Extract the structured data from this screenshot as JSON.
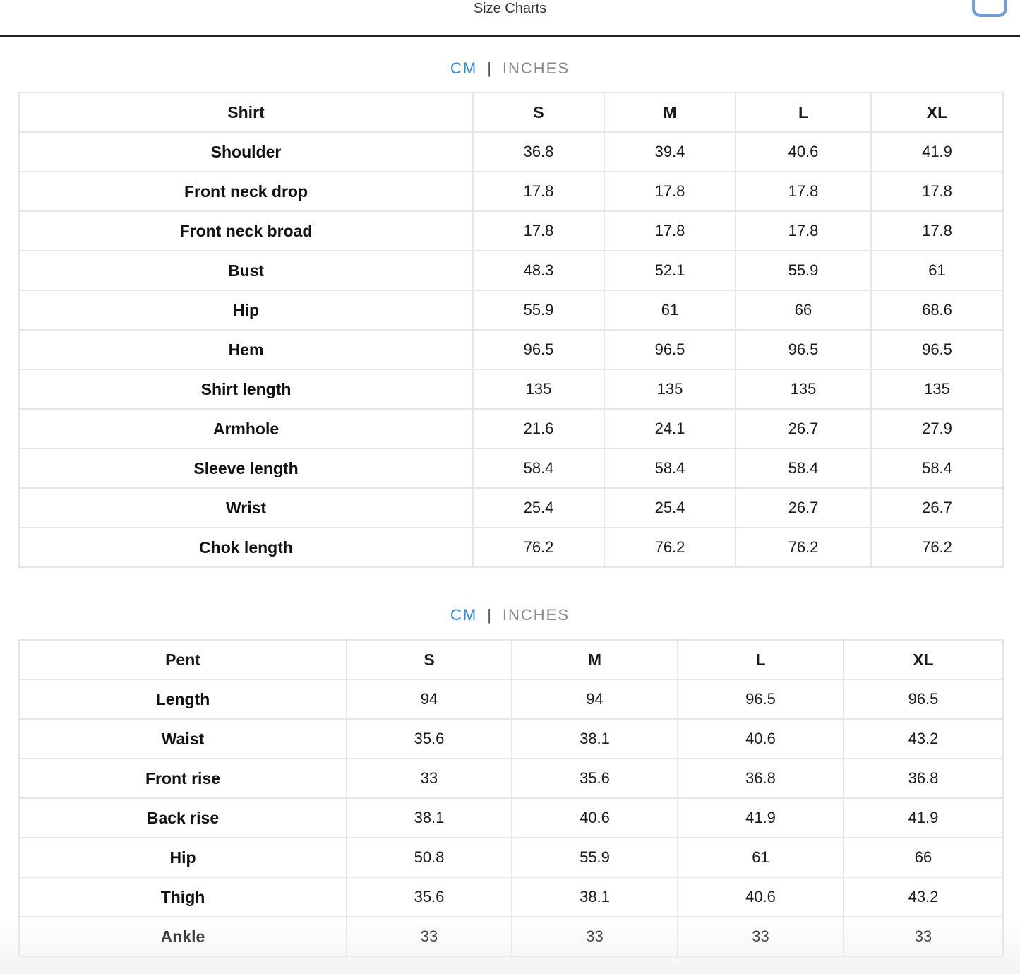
{
  "header": {
    "title": "Size Charts"
  },
  "shirt_chart": {
    "unit_cm": "CM",
    "unit_separator": "|",
    "unit_inches": "INCHES",
    "columns": [
      "Shirt",
      "S",
      "M",
      "L",
      "XL"
    ],
    "rows": [
      [
        "Shoulder",
        "36.8",
        "39.4",
        "40.6",
        "41.9"
      ],
      [
        "Front neck drop",
        "17.8",
        "17.8",
        "17.8",
        "17.8"
      ],
      [
        "Front neck broad",
        "17.8",
        "17.8",
        "17.8",
        "17.8"
      ],
      [
        "Bust",
        "48.3",
        "52.1",
        "55.9",
        "61"
      ],
      [
        "Hip",
        "55.9",
        "61",
        "66",
        "68.6"
      ],
      [
        "Hem",
        "96.5",
        "96.5",
        "96.5",
        "96.5"
      ],
      [
        "Shirt length",
        "135",
        "135",
        "135",
        "135"
      ],
      [
        "Armhole",
        "21.6",
        "24.1",
        "26.7",
        "27.9"
      ],
      [
        "Sleeve length",
        "58.4",
        "58.4",
        "58.4",
        "58.4"
      ],
      [
        "Wrist",
        "25.4",
        "25.4",
        "26.7",
        "26.7"
      ],
      [
        "Chok length",
        "76.2",
        "76.2",
        "76.2",
        "76.2"
      ]
    ]
  },
  "pent_chart": {
    "unit_cm": "CM",
    "unit_separator": "|",
    "unit_inches": "INCHES",
    "columns": [
      "Pent",
      "S",
      "M",
      "L",
      "XL"
    ],
    "rows": [
      [
        "Length",
        "94",
        "94",
        "96.5",
        "96.5"
      ],
      [
        "Waist",
        "35.6",
        "38.1",
        "40.6",
        "43.2"
      ],
      [
        "Front rise",
        "33",
        "35.6",
        "36.8",
        "36.8"
      ],
      [
        "Back rise",
        "38.1",
        "40.6",
        "41.9",
        "41.9"
      ],
      [
        "Hip",
        "50.8",
        "55.9",
        "61",
        "66"
      ],
      [
        "Thigh",
        "35.6",
        "38.1",
        "40.6",
        "43.2"
      ],
      [
        "Ankle",
        "33",
        "33",
        "33",
        "33"
      ]
    ]
  },
  "colors": {
    "accent": "#2a86d8",
    "muted": "#888888",
    "border": "#e6e6e6",
    "corner_outline": "#6f9be6"
  }
}
